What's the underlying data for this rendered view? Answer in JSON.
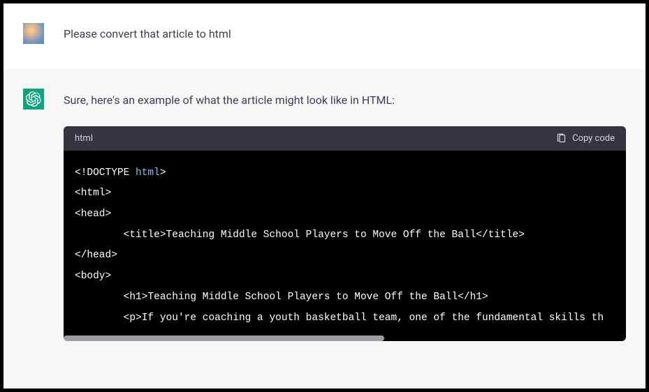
{
  "user": {
    "message": "Please convert that article to html"
  },
  "assistant": {
    "message": "Sure, here's an example of what the article might look like in HTML:"
  },
  "code_block": {
    "language": "html",
    "copy_label": "Copy code",
    "lines": {
      "doctype_prefix": "<!DOCTYPE ",
      "doctype_keyword": "html",
      "doctype_suffix": ">",
      "html_open": "<html>",
      "head_open": "<head>",
      "title": "\t<title>Teaching Middle School Players to Move Off the Ball</title>",
      "head_close": "</head>",
      "body_open": "<body>",
      "h1": "\t<h1>Teaching Middle School Players to Move Off the Ball</h1>",
      "p": "\t<p>If you're coaching a youth basketball team, one of the fundamental skills th"
    }
  }
}
